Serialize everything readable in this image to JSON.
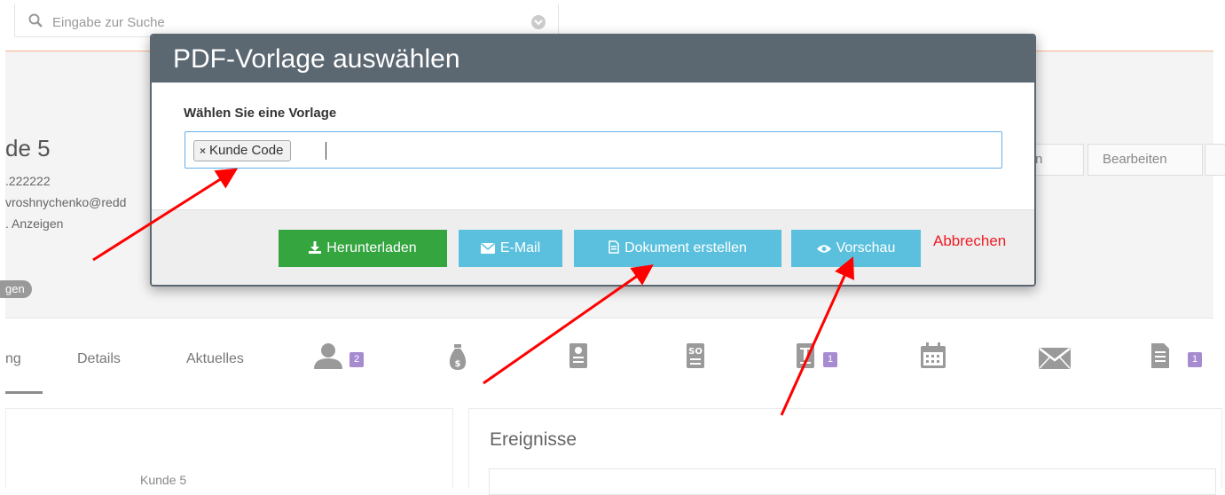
{
  "search": {
    "placeholder": "Eingabe zur Suche"
  },
  "record": {
    "title": "de 5",
    "phone": ".222222",
    "email": "vroshnychenko@redd",
    "show_link": ". Anzeigen",
    "pill": "gen"
  },
  "actions": {
    "partial_button": "n",
    "edit_button": "Bearbeiten"
  },
  "tabs": [
    {
      "label": "ng"
    },
    {
      "label": "Details"
    },
    {
      "label": "Aktuelles"
    }
  ],
  "tab_badges": {
    "contacts": "2",
    "docs": "1",
    "notes": "1"
  },
  "panels": {
    "left_label": "Kunde 5",
    "right_title": "Ereignisse"
  },
  "modal": {
    "title": "PDF-Vorlage auswählen",
    "label": "Wählen Sie eine Vorlage",
    "selected_tag": "Kunde Code",
    "tag_remove": "×",
    "buttons": {
      "download": "Herunterladen",
      "email": "E-Mail",
      "create": "Dokument erstellen",
      "preview": "Vorschau",
      "cancel": "Abbrechen"
    }
  },
  "colors": {
    "header": "#5b6771",
    "download": "#35a540",
    "info": "#5bc0de",
    "cancel": "#ee1c25",
    "arrow": "#ff0000",
    "badge": "#a68bd0"
  },
  "icons": [
    "search-icon",
    "chevron-down-icon",
    "user-icon",
    "money-bag-icon",
    "contact-card-icon",
    "sales-order-icon",
    "invoice-icon",
    "calendar-icon",
    "envelope-icon",
    "document-icon",
    "download-icon",
    "email-icon",
    "file-icon",
    "eye-icon"
  ]
}
